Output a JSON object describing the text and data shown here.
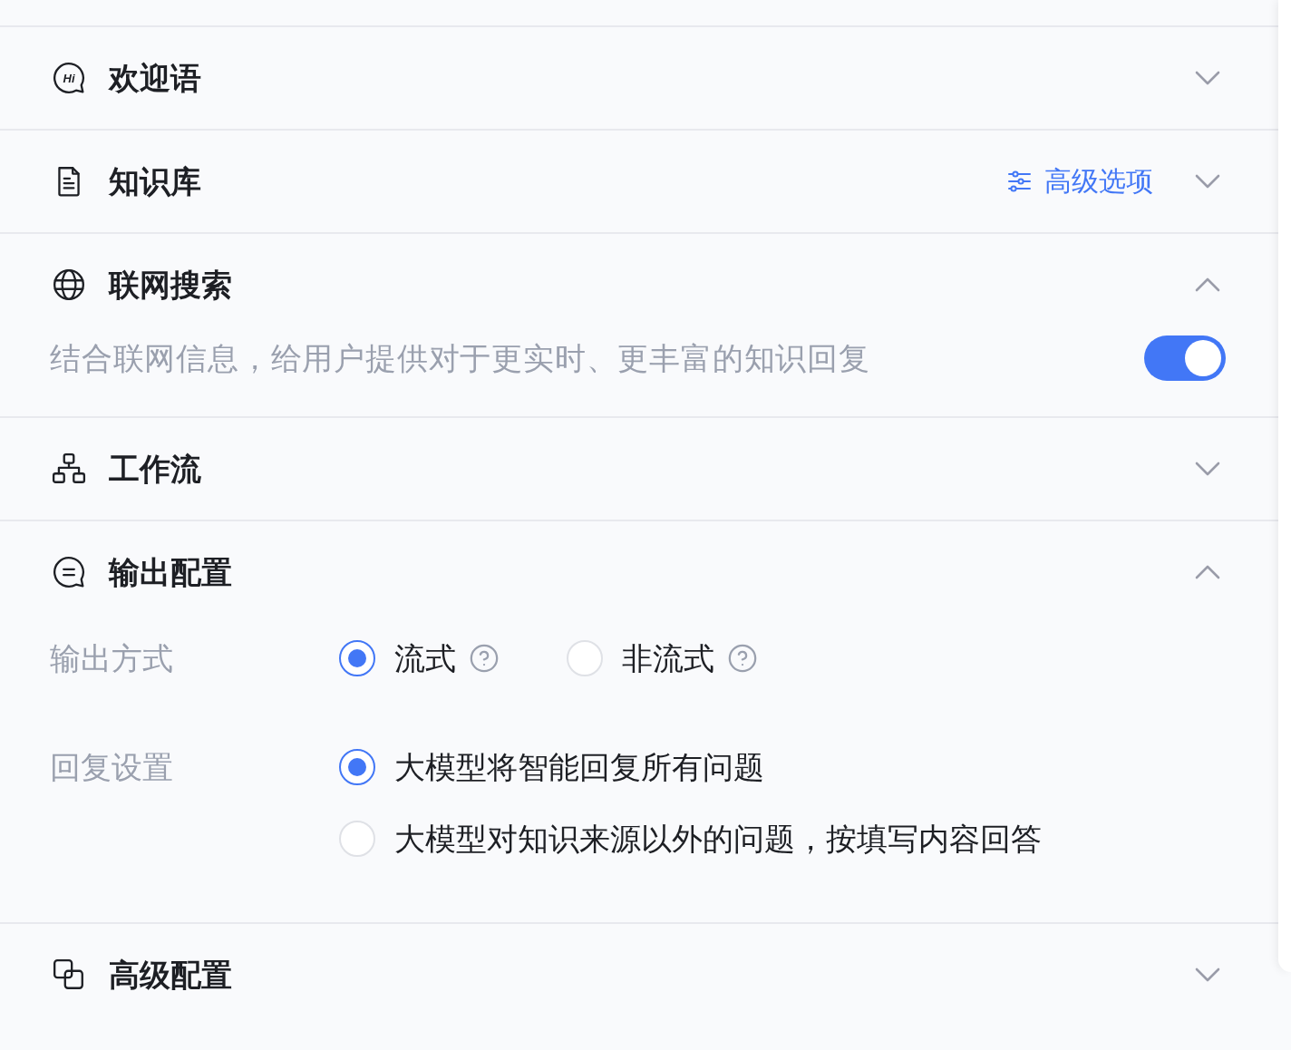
{
  "sections": [
    {
      "kind": "welcome",
      "title": "欢迎语",
      "icon_text": "Hi",
      "expanded": false
    },
    {
      "kind": "knowledge",
      "title": "知识库",
      "expanded": false,
      "action": {
        "label": "高级选项"
      }
    },
    {
      "kind": "web_search",
      "title": "联网搜索",
      "expanded": true,
      "description": "结合联网信息，给用户提供对于更实时、更丰富的知识回复",
      "toggle": {
        "on": true
      }
    },
    {
      "kind": "workflow",
      "title": "工作流",
      "expanded": false
    },
    {
      "kind": "output",
      "title": "输出配置",
      "expanded": true,
      "fields": [
        {
          "kind": "inline",
          "label": "输出方式",
          "options": [
            {
              "label": "流式",
              "selected": true,
              "help": true
            },
            {
              "label": "非流式",
              "selected": false,
              "help": true
            }
          ]
        },
        {
          "kind": "stacked",
          "label": "回复设置",
          "options": [
            {
              "label": "大模型将智能回复所有问题",
              "selected": true,
              "help": false
            },
            {
              "label": "大模型对知识来源以外的问题，按填写内容回答",
              "selected": false,
              "help": false
            }
          ]
        }
      ]
    },
    {
      "kind": "advanced",
      "title": "高级配置",
      "expanded": false
    }
  ]
}
